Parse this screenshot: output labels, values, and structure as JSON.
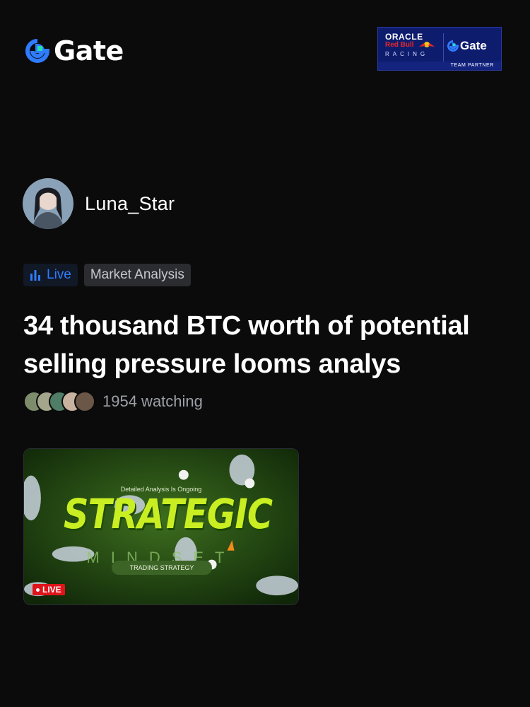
{
  "brand": {
    "name": "Gate"
  },
  "partner": {
    "oracle": "ORACLE",
    "redbull": "Red Bull",
    "racing": "RACING",
    "gate": "Gate",
    "team_partner": "TEAM PARTNER"
  },
  "author": {
    "name": "Luna_Star"
  },
  "tags": {
    "live": "Live",
    "category": "Market Analysis"
  },
  "headline": "34 thousand BTC worth of potential selling pressure looms analys",
  "viewers": {
    "text": "1954 watching"
  },
  "thumbnail": {
    "subtitle": "Detailed Analysis Is Ongoing",
    "title": "STRATEGIC",
    "subtitle2": "MINDSET",
    "pill": "TRADING STRATEGY",
    "live_badge": "LIVE"
  },
  "colors": {
    "background": "#0b0b0c",
    "brand_blue": "#2f7cff",
    "live_red": "#e0141b",
    "lime": "#c9ef22"
  },
  "icons": [
    "gate-logo-icon",
    "live-bars-icon",
    "live-dot-icon"
  ]
}
